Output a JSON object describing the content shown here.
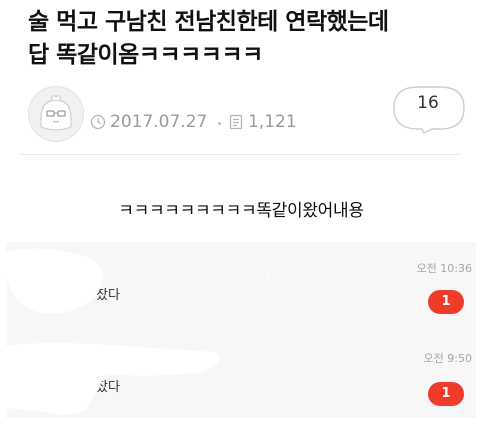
{
  "post": {
    "title_line1": "술   먹고 구남친 전남친한테 연락했는데",
    "title_line2": "답 똑같이옴ㅋㅋㅋㅋㅋㅋ",
    "date": "2017.07.27",
    "views": "1,121",
    "comment_count": "16",
    "caption": "ㅋㅋㅋㅋㅋㅋㅋㅋㅋ똑같이왔어내용"
  },
  "screenshot": {
    "chats": [
      {
        "preview": "잤다",
        "time": "오전 10:36",
        "unread": "1"
      },
      {
        "preview": "잤다",
        "time": "오전 9:50",
        "unread": "1"
      }
    ]
  },
  "icons": {
    "date": "clock-icon",
    "views": "document-icon",
    "comments": "speech-bubble-icon",
    "avatar": "default-profile-icon"
  },
  "colors": {
    "badge": "#ef3b2a",
    "meta_text": "#9a9a9a"
  }
}
